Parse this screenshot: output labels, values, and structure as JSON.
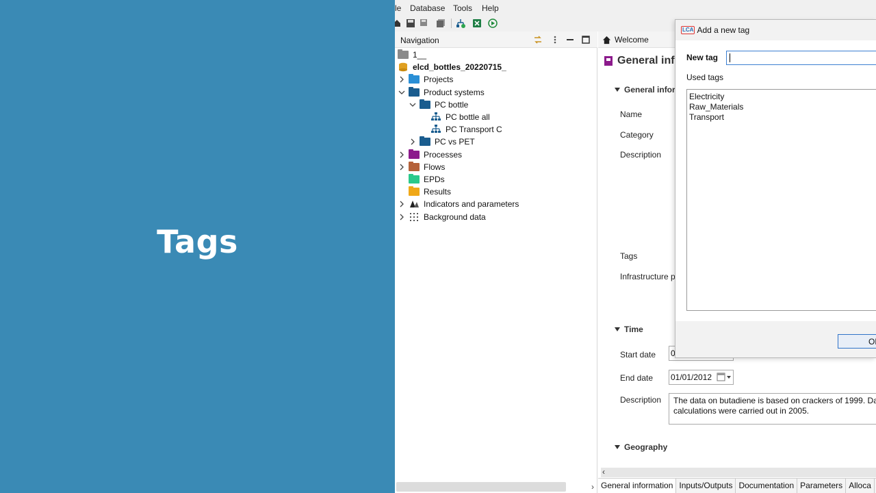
{
  "slide": {
    "title": "Tags"
  },
  "menubar": {
    "items": [
      "le",
      "Database",
      "Tools",
      "Help"
    ]
  },
  "navigation": {
    "title": "Navigation",
    "tree": [
      {
        "label": "1__",
        "color": "#8a8a8a",
        "depth": 0,
        "chevron": "none"
      },
      {
        "label": "elcd_bottles_20220715_",
        "color": "#e0a020",
        "depth": 0,
        "chevron": "none",
        "bold": true
      },
      {
        "label": "Projects",
        "color": "#2a8fd6",
        "depth": 1,
        "chevron": "right"
      },
      {
        "label": "Product systems",
        "color": "#1a5d8f",
        "depth": 1,
        "chevron": "down"
      },
      {
        "label": "PC bottle",
        "color": "#1a5d8f",
        "depth": 2,
        "chevron": "down"
      },
      {
        "label": "PC bottle all",
        "color": "#1a5d8f",
        "depth": 3,
        "chevron": "none",
        "icon": "product-system"
      },
      {
        "label": "PC Transport C",
        "color": "#1a5d8f",
        "depth": 3,
        "chevron": "none",
        "icon": "product-system"
      },
      {
        "label": "PC vs PET",
        "color": "#1a5d8f",
        "depth": 2,
        "chevron": "right"
      },
      {
        "label": "Processes",
        "color": "#8c1a8c",
        "depth": 1,
        "chevron": "right"
      },
      {
        "label": "Flows",
        "color": "#b5623a",
        "depth": 1,
        "chevron": "right"
      },
      {
        "label": "EPDs",
        "color": "#2bc98b",
        "depth": 1,
        "chevron": "none"
      },
      {
        "label": "Results",
        "color": "#f0a818",
        "depth": 1,
        "chevron": "none"
      },
      {
        "label": "Indicators and parameters",
        "color": "#333333",
        "depth": 1,
        "chevron": "right",
        "icon": "indicators"
      },
      {
        "label": "Background data",
        "color": "#555555",
        "depth": 1,
        "chevron": "right",
        "icon": "grid"
      }
    ]
  },
  "editor": {
    "tab": "Welcome",
    "heading": "General inf",
    "sections": {
      "general": "General infor",
      "time": "Time",
      "geography": "Geography"
    },
    "fields": {
      "name": "Name",
      "category": "Category",
      "description": "Description",
      "tags": "Tags",
      "infrastructure": "Infrastructure p",
      "start_date": "Start date",
      "end_date": "End date",
      "time_description": "Description"
    },
    "start_date_value": "0",
    "end_date_value": "01/01/2012",
    "time_description_value": [
      "The data on butadiene is based on crackers of 1999. Dat",
      "calculations were carried out in 2005."
    ],
    "bottom_tabs": [
      "General information",
      "Inputs/Outputs",
      "Documentation",
      "Parameters",
      "Alloca"
    ]
  },
  "dialog": {
    "logo": "LCA",
    "title": "Add a new tag",
    "new_tag_label": "New tag",
    "new_tag_value": "",
    "used_tags_label": "Used tags",
    "used_tags": [
      "Electricity",
      "Raw_Materials",
      "Transport"
    ],
    "ok_label": "OK"
  }
}
